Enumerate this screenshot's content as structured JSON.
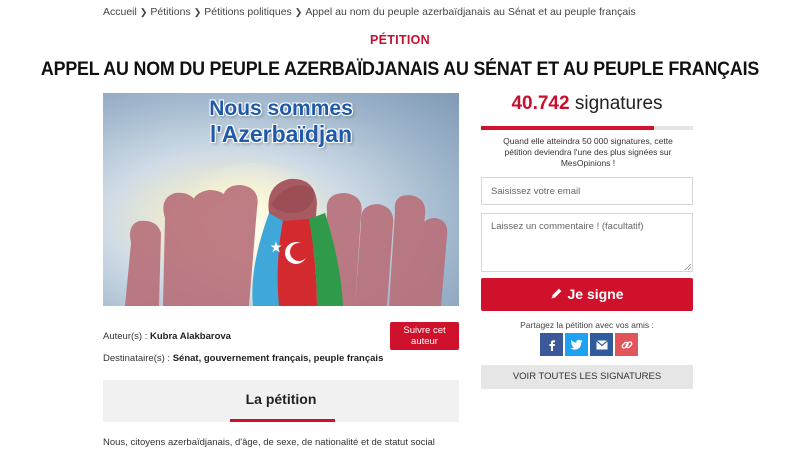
{
  "breadcrumb": {
    "items": [
      "Accueil",
      "Pétitions",
      "Pétitions politiques",
      "Appel au nom du peuple azerbaïdjanais au Sénat et au peuple français"
    ]
  },
  "petition": {
    "kicker": "PÉTITION",
    "title": "APPEL AU NOM DU PEUPLE AZERBAÏDJANAIS AU SÉNAT ET AU PEUPLE FRANÇAIS",
    "image": {
      "headline_line1": "Nous sommes",
      "headline_line2": "l'Azerbaïdjan",
      "flag_colors": {
        "blue": "#3fa8d8",
        "red": "#d32a2f",
        "green": "#2f9a4a"
      }
    },
    "author_label": "Auteur(s) :",
    "author": "Kubra Alakbarova",
    "follow_label": "Suivre cet auteur",
    "recipient_label": "Destinataire(s) :",
    "recipients": "Sénat, gouvernement français, peuple français",
    "section_tab": "La pétition",
    "intro_text": "Nous, citoyens azerbaïdjanais, d'âge, de sexe, de nationalité et de statut social"
  },
  "signatures": {
    "count": "40.742",
    "label": "signatures",
    "goal": 50000,
    "current": 40742,
    "goal_text": "Quand elle atteindra 50 000 signatures, cette pétition deviendra l'une des plus signées sur MesOpinions !"
  },
  "form": {
    "email_placeholder": "Saisissez votre email",
    "comment_placeholder": "Laissez un commentaire ! (facultatif)",
    "sign_label": "Je signe"
  },
  "share": {
    "label": "Partagez la pétition avec vos amis :",
    "buttons": [
      "facebook-icon",
      "twitter-icon",
      "email-icon",
      "link-icon"
    ]
  },
  "all_signatures_label": "VOIR TOUTES LES SIGNATURES",
  "colors": {
    "accent": "#d0112b",
    "kicker": "#c8102e"
  }
}
